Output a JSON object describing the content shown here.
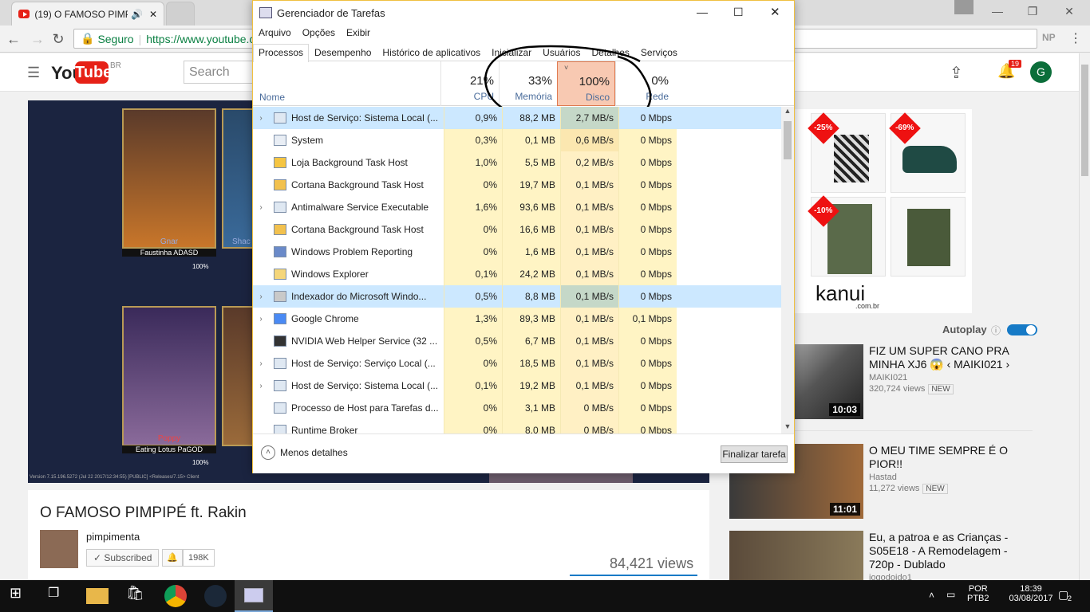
{
  "browser": {
    "tab_title": "(19) O FAMOSO PIMP",
    "secure_label": "Seguro",
    "url": "https://www.youtube.c",
    "profile_initials": "NP"
  },
  "youtube": {
    "logo_you": "You",
    "logo_tube": "Tube",
    "region": "BR",
    "search_placeholder": "Search",
    "notif_count": "19",
    "avatar_letter": "G",
    "video_title": "O FAMOSO PIMPIPÉ ft. Rakin",
    "channel": "pimpimenta",
    "subscribed_label": "Subscribed",
    "sub_count": "198K",
    "views": "84,421 views",
    "ad_brand": "kanui",
    "ad_brand_sub": ".com.br",
    "ad_badges": [
      "-25%",
      "-69%",
      "-10%"
    ],
    "autoplay_label": "Autoplay",
    "recommendations": [
      {
        "title": "FIZ UM SUPER CANO PRA MINHA XJ6 😱 ‹ MAIKI021 ›",
        "channel": "MAIKI021",
        "views": "320,724 views",
        "badge": "NEW",
        "duration": "10:03"
      },
      {
        "title": "O MEU TIME SEMPRE É O PIOR!!",
        "channel": "Hastad",
        "views": "11,272 views",
        "badge": "NEW",
        "duration": "11:01"
      },
      {
        "title": "Eu, a patroa e as Crianças - S05E18 - A Remodelagem - 720p - Dublado",
        "channel": "jogodoido1",
        "views": "",
        "badge": "",
        "duration": ""
      }
    ],
    "video_overlay": {
      "champ1_name": "Gnar",
      "champ1_player": "Faustinha ADASD",
      "champ2_name": "Poppy",
      "champ2_player": "Eating Lotus PaGOD",
      "pct": "100%",
      "version": "Version 7.15.196.5272 (Jul 22 2017/12:34:55) [PUBLIC] <Releases/7.15> Client",
      "shaco": "Shac"
    }
  },
  "taskmanager": {
    "title": "Gerenciador de Tarefas",
    "menu": [
      "Arquivo",
      "Opções",
      "Exibir"
    ],
    "tabs": [
      "Processos",
      "Desempenho",
      "Histórico de aplicativos",
      "Inicializar",
      "Usuários",
      "Detalhes",
      "Serviços"
    ],
    "name_header": "Nome",
    "cpu_pct": "21%",
    "cpu_label": "CPU",
    "mem_pct": "33%",
    "mem_label": "Memória",
    "disk_pct": "100%",
    "disk_label": "Disco",
    "net_pct": "0%",
    "net_label": "Rede",
    "rows": [
      {
        "name": "Host de Serviço: Sistema Local (...",
        "cpu": "0,9%",
        "mem": "88,2 MB",
        "disk": "2,7 MB/s",
        "net": "0 Mbps",
        "expand": true,
        "highlight": true
      },
      {
        "name": "System",
        "cpu": "0,3%",
        "mem": "0,1 MB",
        "disk": "0,6 MB/s",
        "net": "0 Mbps",
        "expand": false
      },
      {
        "name": "Loja Background Task Host",
        "cpu": "1,0%",
        "mem": "5,5 MB",
        "disk": "0,2 MB/s",
        "net": "0 Mbps",
        "expand": false
      },
      {
        "name": "Cortana Background Task Host",
        "cpu": "0%",
        "mem": "19,7 MB",
        "disk": "0,1 MB/s",
        "net": "0 Mbps",
        "expand": false
      },
      {
        "name": "Antimalware Service Executable",
        "cpu": "1,6%",
        "mem": "93,6 MB",
        "disk": "0,1 MB/s",
        "net": "0 Mbps",
        "expand": true
      },
      {
        "name": "Cortana Background Task Host",
        "cpu": "0%",
        "mem": "16,6 MB",
        "disk": "0,1 MB/s",
        "net": "0 Mbps",
        "expand": false
      },
      {
        "name": "Windows Problem Reporting",
        "cpu": "0%",
        "mem": "1,6 MB",
        "disk": "0,1 MB/s",
        "net": "0 Mbps",
        "expand": false
      },
      {
        "name": "Windows Explorer",
        "cpu": "0,1%",
        "mem": "24,2 MB",
        "disk": "0,1 MB/s",
        "net": "0 Mbps",
        "expand": false
      },
      {
        "name": "Indexador do Microsoft Windo...",
        "cpu": "0,5%",
        "mem": "8,8 MB",
        "disk": "0,1 MB/s",
        "net": "0 Mbps",
        "expand": true,
        "highlight": true
      },
      {
        "name": "Google Chrome",
        "cpu": "1,3%",
        "mem": "89,3 MB",
        "disk": "0,1 MB/s",
        "net": "0,1 Mbps",
        "expand": true
      },
      {
        "name": "NVIDIA Web Helper Service (32 ...",
        "cpu": "0,5%",
        "mem": "6,7 MB",
        "disk": "0,1 MB/s",
        "net": "0 Mbps",
        "expand": false
      },
      {
        "name": "Host de Serviço: Serviço Local (...",
        "cpu": "0%",
        "mem": "18,5 MB",
        "disk": "0,1 MB/s",
        "net": "0 Mbps",
        "expand": true
      },
      {
        "name": "Host de Serviço: Sistema Local (...",
        "cpu": "0,1%",
        "mem": "19,2 MB",
        "disk": "0,1 MB/s",
        "net": "0 Mbps",
        "expand": true
      },
      {
        "name": "Processo de Host para Tarefas d...",
        "cpu": "0%",
        "mem": "3,1 MB",
        "disk": "0 MB/s",
        "net": "0 Mbps",
        "expand": false
      },
      {
        "name": "Runtime Broker",
        "cpu": "0%",
        "mem": "8,0 MB",
        "disk": "0 MB/s",
        "net": "0 Mbps",
        "expand": false
      }
    ],
    "less_details": "Menos detalhes",
    "end_task": "Finalizar tarefa"
  },
  "taskbar": {
    "lang1": "POR",
    "lang2": "PTB2",
    "time": "18:39",
    "date": "03/08/2017",
    "notif": "2"
  }
}
